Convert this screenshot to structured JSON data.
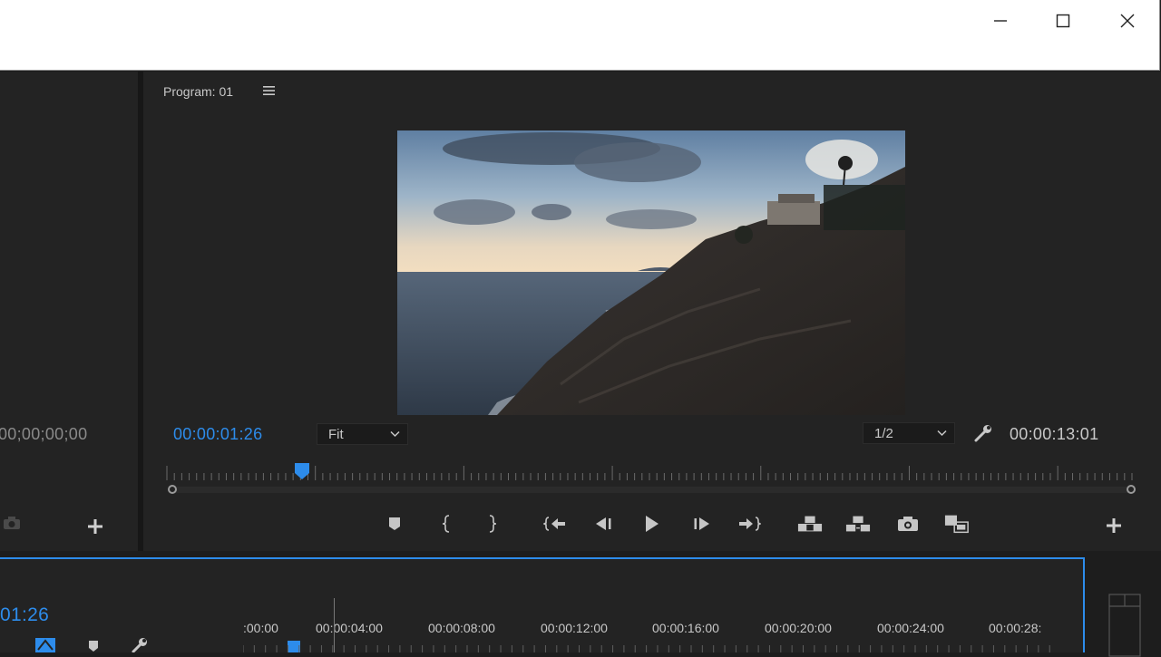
{
  "window": {
    "controls": [
      "minimize",
      "maximize",
      "close"
    ]
  },
  "source_monitor": {
    "timecode": "00;00;00;00"
  },
  "program_monitor": {
    "title": "Program: 01",
    "menu_icon": "hamburger-icon",
    "current_timecode": "00:00:01:26",
    "zoom": "Fit",
    "resolution": "1/2",
    "duration": "00:00:13:01",
    "playhead_fraction": 0.14,
    "transport": [
      "marker-icon",
      "mark-in-icon",
      "mark-out-icon",
      "go-to-in-icon",
      "step-back-icon",
      "play-icon",
      "step-forward-icon",
      "go-to-out-icon",
      "lift-icon",
      "extract-icon",
      "export-frame-icon",
      "comparison-view-icon"
    ]
  },
  "timeline": {
    "timecode": "01:26",
    "ruler_labels": [
      ":00:00",
      "00:00:04:00",
      "00:00:08:00",
      "00:00:12:00",
      "00:00:16:00",
      "00:00:20:00",
      "00:00:24:00",
      "00:00:28:"
    ]
  },
  "colors": {
    "accent": "#2d8ceb",
    "panel": "#232323",
    "background": "#1d1d1d"
  }
}
